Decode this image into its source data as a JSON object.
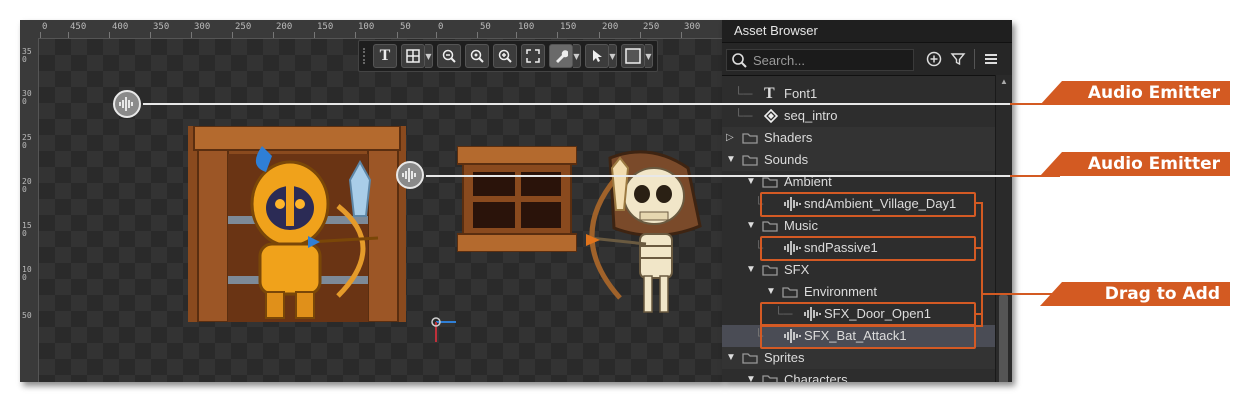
{
  "editor": {
    "ruler_labels": [
      "0",
      "450",
      "400",
      "350",
      "300",
      "250",
      "200",
      "150",
      "100",
      "50",
      "0",
      "50",
      "100",
      "150",
      "200",
      "250",
      "300"
    ],
    "ruler_left_labels": [
      "350",
      "300",
      "250",
      "200",
      "150",
      "100",
      "50"
    ],
    "toolbar": {
      "text_tool": "T",
      "grid_tool": "grid-icon",
      "zoom_out": "zoom-out-icon",
      "zoom_reset": "zoom-reset-icon",
      "zoom_in": "zoom-in-icon",
      "fit": "fit-icon",
      "wrench": "wrench-icon",
      "pointer": "pointer-icon",
      "color": "color-swatch-icon"
    }
  },
  "asset_browser": {
    "title": "Asset Browser",
    "search_placeholder": "Search...",
    "items": [
      {
        "label": "Font1",
        "icon": "font-icon"
      },
      {
        "label": "seq_intro",
        "icon": "sequence-icon"
      },
      {
        "label": "Shaders",
        "icon": "folder-icon"
      },
      {
        "label": "Sounds",
        "icon": "folder-icon"
      },
      {
        "label": "Ambient",
        "icon": "folder-icon"
      },
      {
        "label": "sndAmbient_Village_Day1",
        "icon": "sound-icon"
      },
      {
        "label": "Music",
        "icon": "folder-icon"
      },
      {
        "label": "sndPassive1",
        "icon": "sound-icon"
      },
      {
        "label": "SFX",
        "icon": "folder-icon"
      },
      {
        "label": "Environment",
        "icon": "folder-icon"
      },
      {
        "label": "SFX_Door_Open1",
        "icon": "sound-icon"
      },
      {
        "label": "SFX_Bat_Attack1",
        "icon": "sound-icon"
      },
      {
        "label": "Sprites",
        "icon": "folder-icon"
      },
      {
        "label": "Characters",
        "icon": "folder-icon"
      }
    ]
  },
  "callouts": {
    "emitter1": "Audio Emitter",
    "emitter2": "Audio Emitter",
    "drag": "Drag to Add"
  },
  "colors": {
    "accent": "#d35a22",
    "panel": "#2d2d2d",
    "selection": "#4a4c55"
  }
}
